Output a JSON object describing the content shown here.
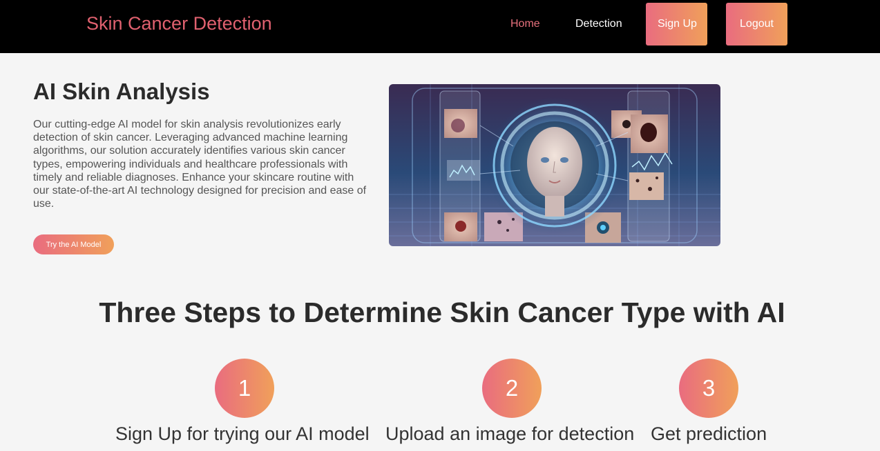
{
  "nav": {
    "brand": "Skin Cancer Detection",
    "home": "Home",
    "detection": "Detection",
    "signup": "Sign Up",
    "logout": "Logout"
  },
  "hero": {
    "title": "AI Skin Analysis",
    "description": "Our cutting-edge AI model for skin analysis revolutionizes early detection of skin cancer. Leveraging advanced machine learning algorithms, our solution accurately identifies various skin cancer types, empowering individuals and healthcare professionals with timely and reliable diagnoses. Enhance your skincare routine with our state-of-the-art AI technology designed for precision and ease of use.",
    "cta": "Try the AI Model"
  },
  "steps": {
    "title": "Three Steps to Determine Skin Cancer Type with AI",
    "items": [
      {
        "number": "1",
        "label": "Sign Up for trying our AI model"
      },
      {
        "number": "2",
        "label": "Upload an image for detection"
      },
      {
        "number": "3",
        "label": "Get prediction"
      }
    ]
  },
  "colors": {
    "gradient_start": "#e96c7f",
    "gradient_end": "#f0a05a",
    "navbar_bg": "#000000",
    "brand": "#e0616f"
  }
}
